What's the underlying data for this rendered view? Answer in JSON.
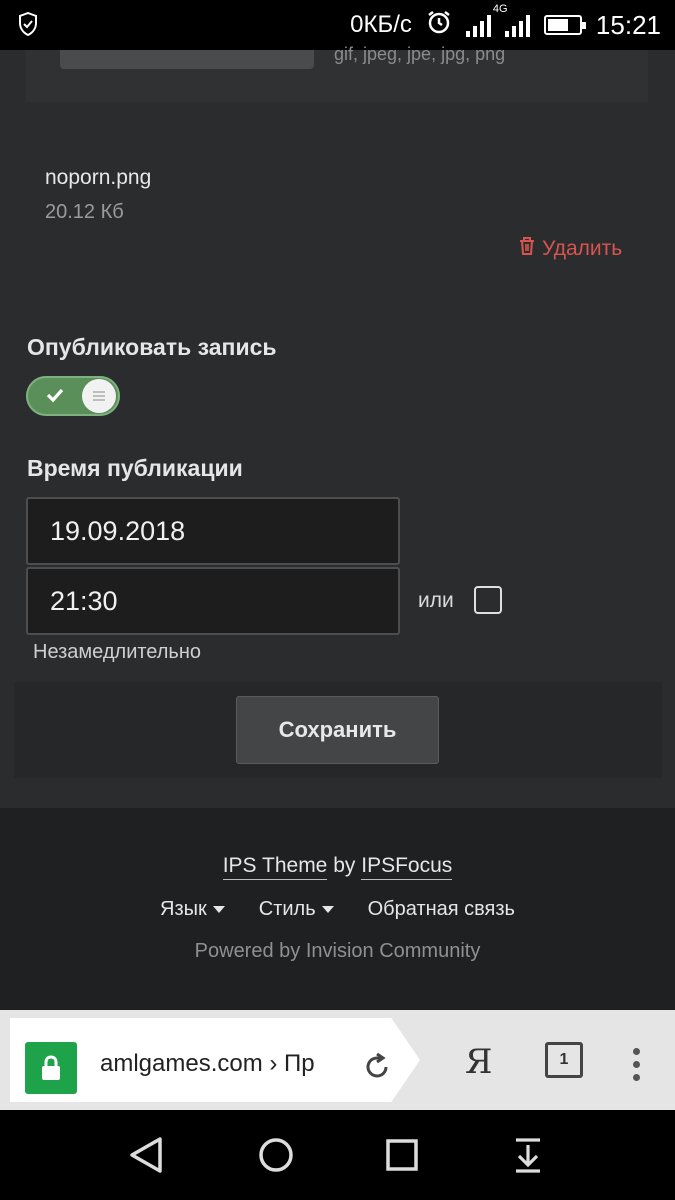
{
  "status_bar": {
    "speed": "0КБ/с",
    "network": "4G",
    "time": "15:21",
    "icons": [
      "shield-icon",
      "alarm-icon",
      "signal-icon",
      "battery-icon"
    ]
  },
  "upload": {
    "allowed_types": "gif, jpeg, jpe, jpg, png",
    "file_name": "noporn.png",
    "file_size": "20.12 Кб",
    "delete_label": "Удалить"
  },
  "form": {
    "publish_label": "Опубликовать запись",
    "publish_enabled": true,
    "time_label": "Время публикации",
    "date_value": "19.09.2018",
    "time_value": "21:30",
    "or_label": "или",
    "immediately_label": "Незамедлительно",
    "immediately_checked": false,
    "save_label": "Сохранить"
  },
  "footer": {
    "theme_link": "IPS Theme",
    "by_text": "by",
    "author_link": "IPSFocus",
    "language": "Язык",
    "style": "Стиль",
    "feedback": "Обратная связь",
    "powered": "Powered by Invision Community"
  },
  "browser": {
    "url": "amlgames.com › Пр",
    "yandex": "Я",
    "tab_count": "1"
  },
  "colors": {
    "background": "#2b2c2e",
    "delete": "#d8544f",
    "toggle_on": "#5a8f5a",
    "lock": "#1ea34a"
  }
}
